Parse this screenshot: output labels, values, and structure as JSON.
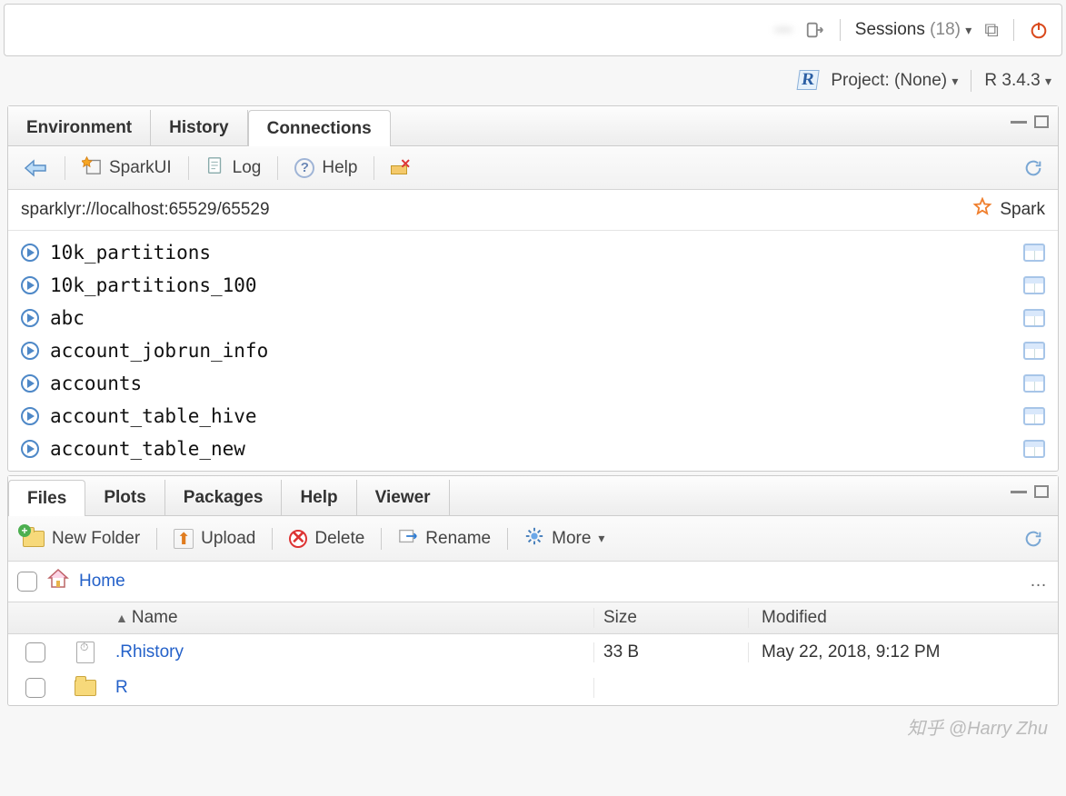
{
  "top": {
    "blurred_user": "—",
    "sessions_label": "Sessions",
    "sessions_count": "(18)"
  },
  "secondary": {
    "project_label": "Project:",
    "project_value": "(None)",
    "r_version": "R 3.4.3"
  },
  "upper_panel": {
    "tabs": [
      "Environment",
      "History",
      "Connections"
    ],
    "active_index": 2,
    "toolbar": {
      "sparkui": "SparkUI",
      "log": "Log",
      "help": "Help"
    },
    "address": "sparklyr://localhost:65529/65529",
    "spark_label": "Spark",
    "tables": [
      "10k_partitions",
      "10k_partitions_100",
      "abc",
      "account_jobrun_info",
      "accounts",
      "account_table_hive",
      "account_table_new"
    ]
  },
  "lower_panel": {
    "tabs": [
      "Files",
      "Plots",
      "Packages",
      "Help",
      "Viewer"
    ],
    "active_index": 0,
    "toolbar": {
      "new_folder": "New Folder",
      "upload": "Upload",
      "delete": "Delete",
      "rename": "Rename",
      "more": "More"
    },
    "breadcrumb": "Home",
    "columns": {
      "name": "Name",
      "size": "Size",
      "modified": "Modified"
    },
    "rows": [
      {
        "type": "file",
        "name": ".Rhistory",
        "size": "33 B",
        "modified": "May 22, 2018, 9:12 PM"
      },
      {
        "type": "folder",
        "name": "R",
        "size": "",
        "modified": ""
      }
    ]
  },
  "watermark": "知乎 @Harry Zhu"
}
